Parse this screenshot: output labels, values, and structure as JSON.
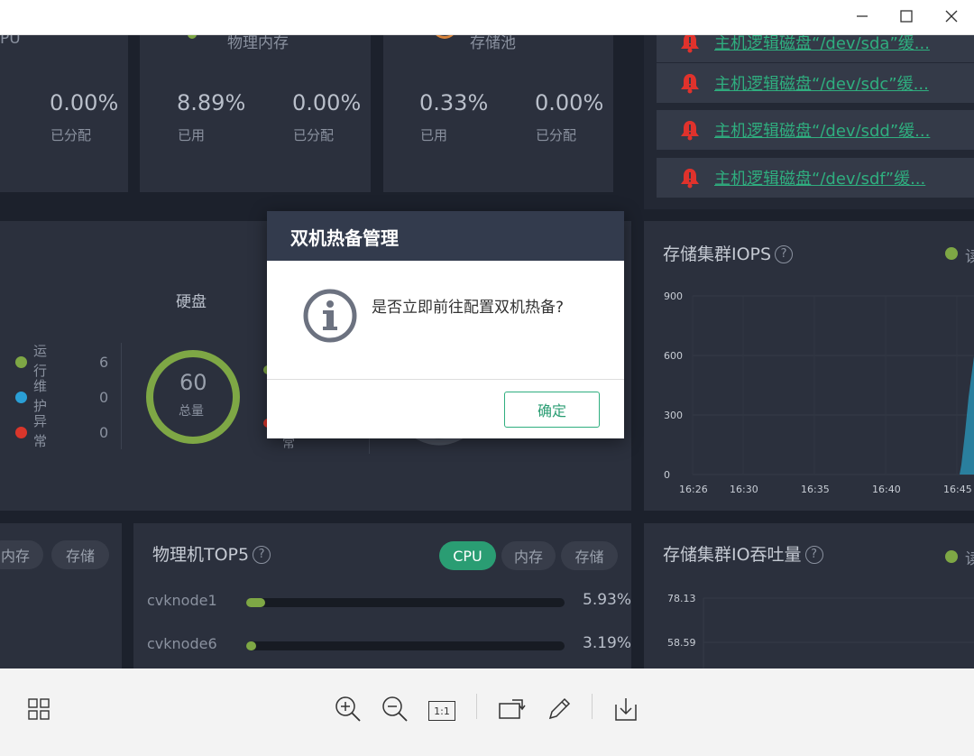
{
  "window": {
    "minimize_icon": "minimize-icon",
    "maximize_icon": "maximize-icon",
    "close_icon": "close-icon"
  },
  "resource_cards": [
    {
      "title_partial": "PU",
      "stats": [
        {
          "value": "0.00%",
          "label": "已分配"
        }
      ]
    },
    {
      "title_partial": "物理内存",
      "stats": [
        {
          "value": "8.89%",
          "label": "已用"
        },
        {
          "value": "0.00%",
          "label": "已分配"
        }
      ]
    },
    {
      "title_partial": "存储池",
      "stats": [
        {
          "value": "0.33%",
          "label": "已用"
        },
        {
          "value": "0.00%",
          "label": "已分配"
        }
      ]
    }
  ],
  "alarms": [
    {
      "text": "主机逻辑磁盘“/dev/sda”缓..."
    },
    {
      "text": "主机逻辑磁盘“/dev/sdc”缓..."
    },
    {
      "text": "主机逻辑磁盘“/dev/sdd”缓..."
    },
    {
      "text": "主机逻辑磁盘“/dev/sdf”缓..."
    }
  ],
  "status_panel": {
    "legend": [
      {
        "label": "运行",
        "count": "6",
        "color": "#7ea745"
      },
      {
        "label": "维护",
        "count": "0",
        "color": "#2a9fd6"
      },
      {
        "label": "异常",
        "count": "0",
        "color": "#d9362b"
      }
    ],
    "disk": {
      "title": "硬盘",
      "total_value": "60",
      "total_label": "总量",
      "partial_label": "常"
    }
  },
  "iops_panel": {
    "title": "存储集群IOPS",
    "legend_partial": "读",
    "chart_data": {
      "type": "line",
      "x": [
        "16:26",
        "16:30",
        "16:35",
        "16:40",
        "16:45"
      ],
      "yticks": [
        "900",
        "600",
        "300",
        "0"
      ],
      "ylim": [
        0,
        900
      ]
    }
  },
  "io_panel": {
    "title": "存储集群IO吞吐量",
    "legend_partial": "读",
    "chart_data": {
      "type": "line",
      "yticks": [
        "78.13",
        "58.59"
      ]
    }
  },
  "vm_panel": {
    "tabs": [
      "内存",
      "存储"
    ]
  },
  "top5_panel": {
    "title": "物理机TOP5",
    "tabs": [
      {
        "label": "CPU",
        "active": true
      },
      {
        "label": "内存",
        "active": false
      },
      {
        "label": "存储",
        "active": false
      }
    ],
    "rows": [
      {
        "name": "cvknode1",
        "value": "5.93%",
        "fraction": 0.0593
      },
      {
        "name": "cvknode6",
        "value": "3.19%",
        "fraction": 0.0319
      }
    ]
  },
  "modal": {
    "title": "双机热备管理",
    "message": "是否立即前往配置双机热备?",
    "ok_label": "确定",
    "icon": "info-icon"
  },
  "toolbar": {
    "icons": [
      "grid-view-icon",
      "zoom-in-icon",
      "zoom-out-icon",
      "actual-size-icon",
      "rotate-icon",
      "edit-icon",
      "save-icon"
    ],
    "actual_size_label": "1:1"
  },
  "colors": {
    "accent": "#2a9d73",
    "running": "#7ea745",
    "maintenance": "#2a9fd6",
    "abnormal": "#d9362b",
    "modal_header": "#333b4d"
  }
}
